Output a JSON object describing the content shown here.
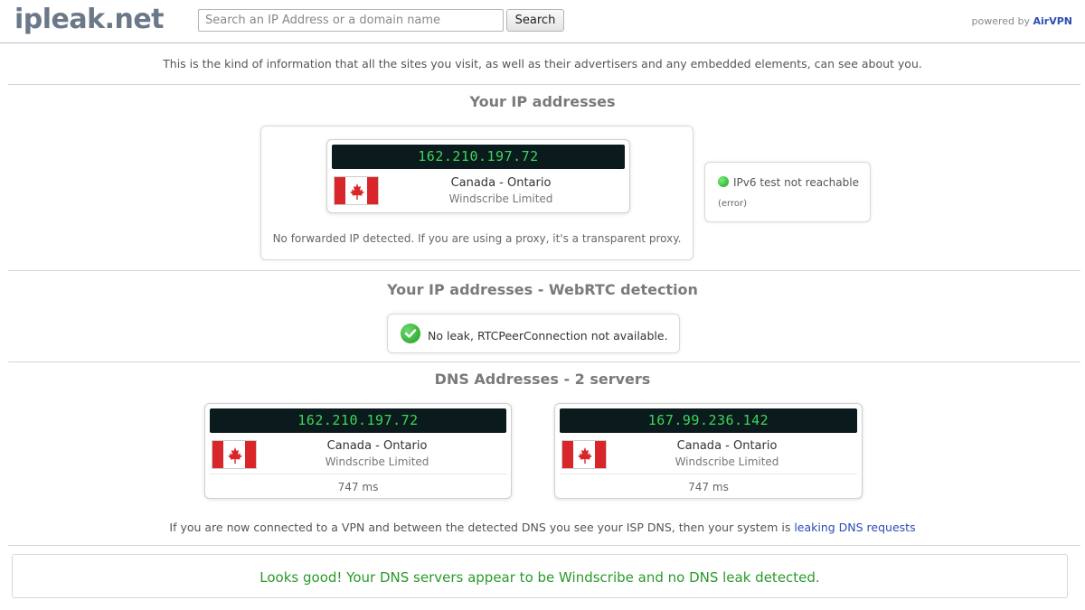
{
  "header": {
    "logo": "ipleak.net",
    "search_placeholder": "Search an IP Address or a domain name",
    "search_button": "Search",
    "powered_prefix": "powered by ",
    "powered_brand": "AirVPN"
  },
  "intro": "This is the kind of information that all the sites you visit, as well as their advertisers and any embedded elements, can see about you.",
  "ip_section": {
    "title": "Your IP addresses",
    "ip": "162.210.197.72",
    "location": "Canada - Ontario",
    "isp": "Windscribe Limited",
    "note": "No forwarded IP detected. If you are using a proxy, it's a transparent proxy.",
    "ipv6_status": "IPv6 test not reachable",
    "ipv6_error": "(error)"
  },
  "webrtc_section": {
    "title": "Your IP addresses - WebRTC detection",
    "status": "No leak, RTCPeerConnection not available."
  },
  "dns_section": {
    "title": "DNS Addresses - 2 servers",
    "servers": [
      {
        "ip": "162.210.197.72",
        "location": "Canada - Ontario",
        "isp": "Windscribe Limited",
        "latency": "747 ms"
      },
      {
        "ip": "167.99.236.142",
        "location": "Canada - Ontario",
        "isp": "Windscribe Limited",
        "latency": "747 ms"
      }
    ],
    "note_prefix": "If you are now connected to a VPN and between the detected DNS you see your ISP DNS, then your system is ",
    "note_link": "leaking DNS requests"
  },
  "result": "Looks good! Your DNS servers appear to be Windscribe and no DNS leak detected.",
  "colors": {
    "ip_text": "#3cd65a",
    "ip_bar_bg": "#0b1a1c",
    "ok_green": "#2a9a2a",
    "link_blue": "#2a4db4",
    "flag_red": "#d8262a"
  }
}
